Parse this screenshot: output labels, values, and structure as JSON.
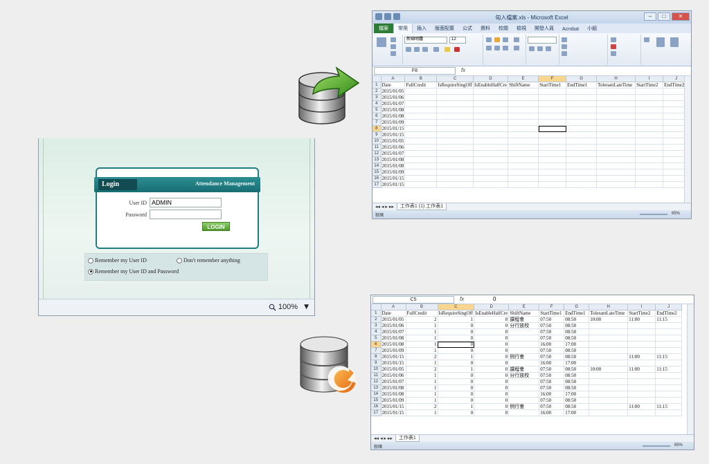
{
  "login": {
    "tab": "Login",
    "app_name": "Attendance Management",
    "userid_label": "User ID",
    "userid_value": "ADMIN",
    "password_label": "Password",
    "password_value": "",
    "button": "LOGIN",
    "options": [
      {
        "label": "Remember my User ID",
        "checked": false
      },
      {
        "label": "Don't remember anything",
        "checked": false
      },
      {
        "label": "Remember my User ID and Password",
        "checked": true
      }
    ],
    "zoom": "100%"
  },
  "excel_top": {
    "title": "匈入檔案.xls - Microsoft Excel",
    "tabs": [
      "檔案",
      "常用",
      "插入",
      "版面配置",
      "公式",
      "資料",
      "校閱",
      "檢視",
      "開發人員",
      "Acrobat",
      "小組"
    ],
    "font_name": "新細明體",
    "font_size": "12",
    "namebox": "F8",
    "formula": "",
    "columns": [
      "A",
      "B",
      "C",
      "D",
      "E",
      "F",
      "G",
      "H",
      "I",
      "J"
    ],
    "header_row": [
      "Date",
      "FullCredit",
      "IsRequireSingOff",
      "IsEnableHalfCre",
      "ShiftName",
      "StartTime1",
      "EndTime1",
      "TolerantLateTime",
      "StartTime2",
      "EndTime2"
    ],
    "dates": [
      "2015/01/05",
      "2015/01/06",
      "2015/01/07",
      "2015/01/08",
      "2015/01/08",
      "2015/01/09",
      "2015/01/15",
      "2015/01/15",
      "2015/01/05",
      "2015/01/06",
      "2015/01/07",
      "2015/01/08",
      "2015/01/08",
      "2015/01/09",
      "2015/01/15",
      "2015/01/15"
    ],
    "sheet_tabs": "工作表1 (1)  工作表1",
    "status": "就緒",
    "zoom": "85%"
  },
  "excel_bottom": {
    "namebox": "C5",
    "formula": "0",
    "columns": [
      "A",
      "B",
      "C",
      "D",
      "E",
      "F",
      "G",
      "H",
      "I",
      "J"
    ],
    "header_row": [
      "Date",
      "FullCredit",
      "IsRequireSingOff",
      "IsEnableHalfCre",
      "ShiftName",
      "StartTime1",
      "EndTime1",
      "TolerantLateTime",
      "StartTime2",
      "EndTime2"
    ],
    "rows": [
      [
        "2015/01/05",
        "2",
        "1",
        "0",
        "課程會",
        "07:50",
        "08:50",
        "10:00",
        "11:00",
        "11:15"
      ],
      [
        "2015/01/06",
        "1",
        "0",
        "0",
        "分行放校",
        "07:50",
        "08:50",
        "",
        "",
        ""
      ],
      [
        "2015/01/07",
        "1",
        "0",
        "0",
        "",
        "07:50",
        "08:50",
        "",
        "",
        ""
      ],
      [
        "2015/01/08",
        "1",
        "0",
        "0",
        "",
        "07:50",
        "08:50",
        "",
        "",
        ""
      ],
      [
        "2015/01/08",
        "1",
        "0",
        "0",
        "",
        "16:00",
        "17:00",
        "",
        "",
        ""
      ],
      [
        "2015/01/09",
        "1",
        "0",
        "0",
        "",
        "07:50",
        "08:50",
        "",
        "",
        ""
      ],
      [
        "2015/01/15",
        "2",
        "1",
        "0",
        "例行會",
        "07:50",
        "08:50",
        "",
        "11:00",
        "11:15"
      ],
      [
        "2015/01/15",
        "1",
        "0",
        "0",
        "",
        "16:00",
        "17:00",
        "",
        "",
        ""
      ],
      [
        "2015/01/05",
        "2",
        "1",
        "0",
        "課程會",
        "07:50",
        "08:50",
        "10:00",
        "11:00",
        "11:15"
      ],
      [
        "2015/01/06",
        "1",
        "0",
        "0",
        "分行放校",
        "07:50",
        "08:50",
        "",
        "",
        ""
      ],
      [
        "2015/01/07",
        "1",
        "0",
        "0",
        "",
        "07:50",
        "08:50",
        "",
        "",
        ""
      ],
      [
        "2015/01/08",
        "1",
        "0",
        "0",
        "",
        "07:50",
        "08:50",
        "",
        "",
        ""
      ],
      [
        "2015/01/08",
        "1",
        "0",
        "0",
        "",
        "16:00",
        "17:00",
        "",
        "",
        ""
      ],
      [
        "2015/01/09",
        "1",
        "0",
        "0",
        "",
        "07:50",
        "08:50",
        "",
        "",
        ""
      ],
      [
        "2015/01/15",
        "2",
        "1",
        "0",
        "例行會",
        "07:50",
        "08:50",
        "",
        "11:00",
        "11:15"
      ],
      [
        "2015/01/15",
        "1",
        "0",
        "0",
        "",
        "16:00",
        "17:00",
        "",
        "",
        ""
      ]
    ],
    "sheet_tab": "工作表1",
    "status": "就緒",
    "zoom": "85%"
  }
}
